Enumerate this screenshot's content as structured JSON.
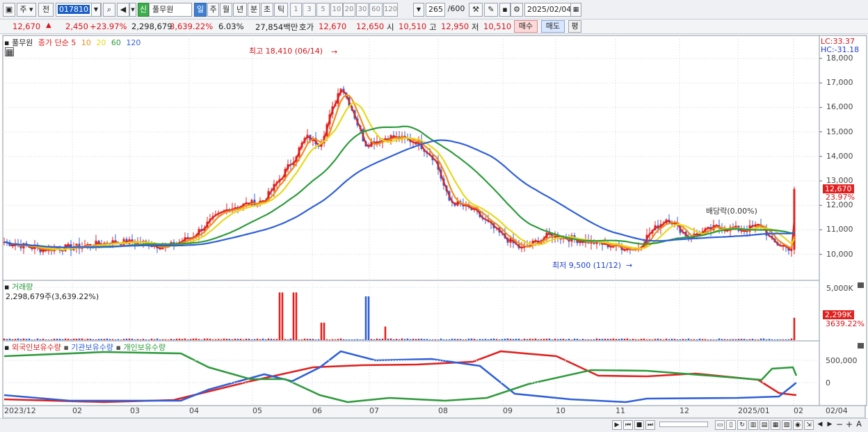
{
  "toolbar": {
    "period_unit": "주",
    "prev_label": "전",
    "code": "017810",
    "name_badge": "신",
    "stock_name": "풀무원",
    "tabs": [
      "일",
      "주",
      "월",
      "년",
      "분",
      "초",
      "틱"
    ],
    "intervals": [
      "1",
      "3",
      "5",
      "10",
      "20",
      "30",
      "60",
      "120"
    ],
    "count": "265",
    "count_max": "/600",
    "date": "2025/02/04"
  },
  "quote": {
    "price": "12,670",
    "change": "2,450",
    "pct": "+23.97%",
    "volume": "2,298,679",
    "vol_pct": "3,639.22%",
    "turnover": "6.03%",
    "amount": "27,854백만",
    "hoga_label": "호가",
    "ask": "12,670",
    "bid": "12,650",
    "open_label": "시",
    "open": "10,510",
    "high_label": "고",
    "high": "12,950",
    "low_label": "저",
    "low": "10,510",
    "buy": "매수",
    "sell": "매도",
    "eval": "평"
  },
  "price_panel": {
    "name": "풀무원",
    "legend_prefix": "종가 단순",
    "ma": [
      {
        "label": "5",
        "color": "#e0201f"
      },
      {
        "label": "10",
        "color": "#f08c1a"
      },
      {
        "label": "20",
        "color": "#e8d81c"
      },
      {
        "label": "60",
        "color": "#2e9a3c"
      },
      {
        "label": "120",
        "color": "#2f5fd8"
      }
    ],
    "lc": "LC:33.37",
    "hc": "HC:-31.18",
    "yticks": [
      "18,000",
      "17,000",
      "16,000",
      "15,000",
      "14,000",
      "13,000",
      "12,000",
      "11,000",
      "10,000"
    ],
    "last_price": "12,670",
    "last_pct": "23.97%",
    "high_note": "최고 18,410 (06/14)",
    "low_note": "최저 9,500 (11/12)",
    "dividend_note": "배당락(0.00%)"
  },
  "volume_panel": {
    "title": "거래량",
    "value": "2,298,679주(3,639.22%)",
    "ytick": "5,000K",
    "last": "2,299K",
    "last_pct": "3639.22%"
  },
  "holding_panel": {
    "series": [
      "외국인보유수량",
      "기관보유수량",
      "개인보유수량"
    ],
    "colors": [
      "#e0201f",
      "#2f5fd8",
      "#2e9a3c"
    ],
    "yticks": [
      "500,000",
      "0"
    ]
  },
  "xaxis": [
    "2023/12",
    "02",
    "03",
    "04",
    "05",
    "06",
    "07",
    "08",
    "09",
    "10",
    "11",
    "12",
    "2025/01",
    "02",
    "02/04"
  ],
  "colors": {
    "up": "#e0201f",
    "down": "#2f5fd8"
  }
}
